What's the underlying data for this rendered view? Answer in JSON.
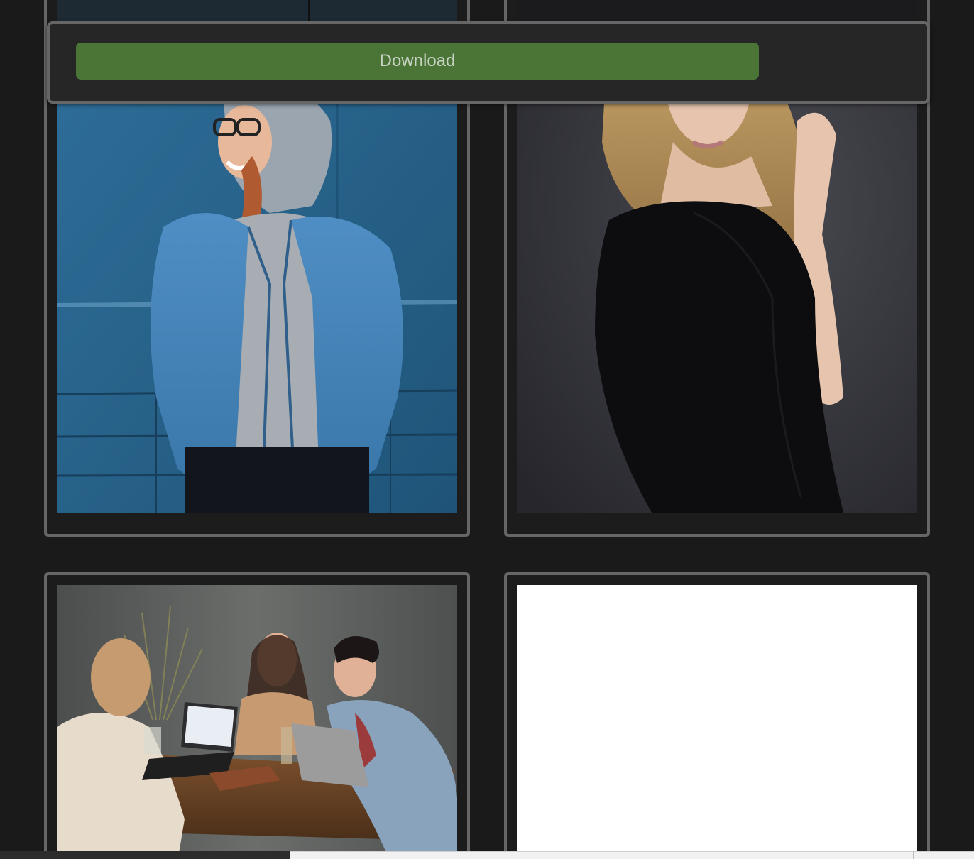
{
  "toolbar": {
    "download_label": "Download",
    "button_color": "#4a7537"
  },
  "gallery": {
    "images": [
      {
        "name": "woman-denim-jacket-hoodie-photo",
        "description_visible": false
      },
      {
        "name": "blonde-woman-black-top-photo",
        "description_visible": false
      },
      {
        "name": "friends-at-cafe-table-laptops-photo",
        "description_visible": false
      },
      {
        "name": "blank-image-placeholder",
        "description_visible": false
      }
    ]
  },
  "colors": {
    "page_background": "#1a1a1a",
    "card_border": "#666666",
    "toolbar_background": "#262626"
  }
}
